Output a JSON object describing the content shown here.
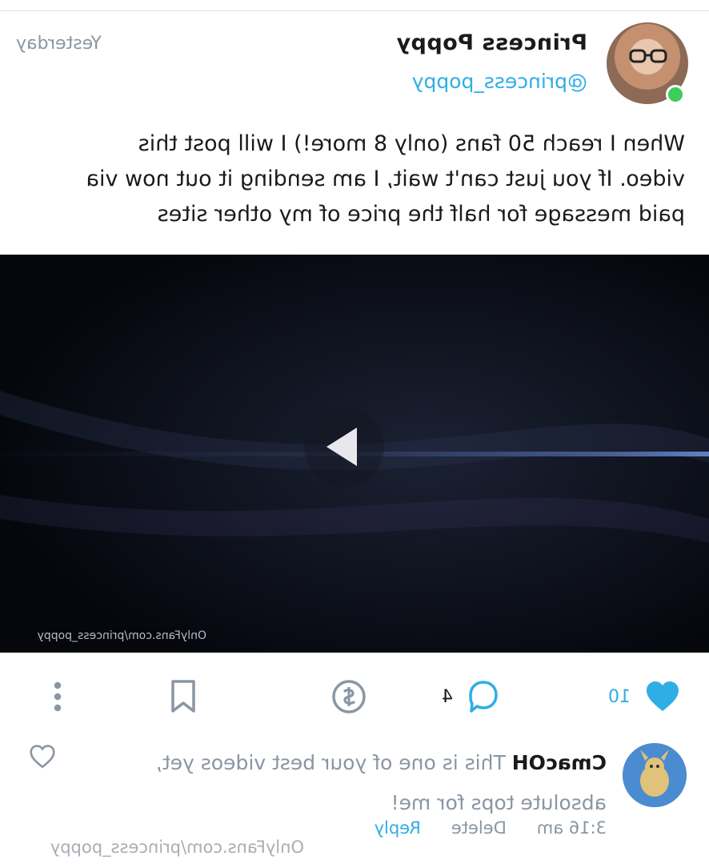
{
  "post": {
    "author_name": "Princess Poppy",
    "handle": "@princess_poppy",
    "timestamp": "Yesterday",
    "text": "When I reach 50 fans (only 8 more!) I will post this video. If you just can't wait, I am sending it out now via paid message for half the price of my other sites"
  },
  "video": {
    "watermark": "OnlyFans.com/princess_poppy",
    "play_icon": "play-icon"
  },
  "actions": {
    "likes": "10",
    "comments": "4",
    "icons": [
      "heart-icon",
      "comment-icon",
      "tip-dollar-icon",
      "bookmark-icon",
      "more-vertical-icon"
    ]
  },
  "comment": {
    "author": "CmacOH",
    "text": "This is one of your best videos yet, absolute tops for me!",
    "time": "3:16 am",
    "delete_label": "Delete",
    "reply_label": "Reply"
  },
  "footer": {
    "watermark": "OnlyFans.com/princess_poppy"
  },
  "colors": {
    "accent": "#2faee6",
    "online": "#3ccd5a",
    "muted": "#8a96a3",
    "text": "#1a1a1a"
  }
}
